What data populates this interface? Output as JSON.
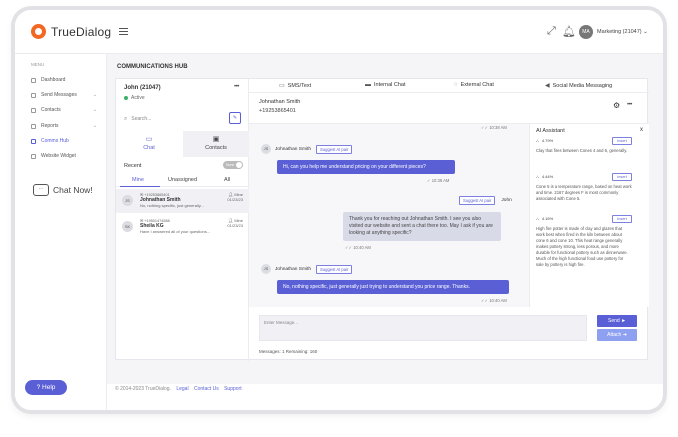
{
  "brand": {
    "name": "TrueDialog",
    "accent": "#5a5fd6",
    "logo_color": "#f26722"
  },
  "topbar": {
    "icons": [
      "expand-icon",
      "bell-icon"
    ],
    "avatar_initials": "MA",
    "account_label": "Marketing (21047)"
  },
  "sidebar": {
    "heading": "MENU",
    "items": [
      {
        "label": "Dashboard",
        "has_chevron": false
      },
      {
        "label": "Send Messages",
        "has_chevron": true
      },
      {
        "label": "Contacts",
        "has_chevron": true
      },
      {
        "label": "Reports",
        "has_chevron": true
      },
      {
        "label": "Comms Hub",
        "has_chevron": false,
        "active": true
      },
      {
        "label": "Website Widget",
        "has_chevron": false
      }
    ],
    "chat_now": "Chat Now!",
    "help": "Help"
  },
  "main": {
    "title": "COMMUNICATIONS HUB",
    "account": {
      "name": "John (21047)",
      "status": "Active"
    },
    "search_placeholder": "Search...",
    "tabs": {
      "chat": "Chat",
      "contacts": "Contacts"
    },
    "recent_label": "Recent",
    "toggle_label": "None",
    "subtabs": {
      "mine": "Mine",
      "unassigned": "Unassigned",
      "all": "All"
    },
    "conversations": [
      {
        "initials": "JS",
        "phone": "+19253865401",
        "name": "Johnathan Smith",
        "preview": "No, nothing specific, just generally...",
        "owner": "Mine",
        "date": "01/23/23"
      },
      {
        "initials": "SK",
        "phone": "+19501474588",
        "name": "Sheila KG",
        "preview": "Have I answered all of your questions...",
        "owner": "Mine",
        "date": "01/23/23"
      }
    ]
  },
  "chat": {
    "channels": [
      "SMS/Text",
      "Internal Chat",
      "External Chat",
      "Social Media Messaging"
    ],
    "contact_name": "Johnathan Smith",
    "contact_phone": "+19253865401",
    "messages": {
      "time_top": "10:38 AM",
      "m1_sender": "Johnathan Smith",
      "m1_initials": "JS",
      "m1_suggest": "Suggest AI pair",
      "m1_text": "Hi, can you help me understand pricing on your different pieces?",
      "m1_time": "10:39 AM",
      "m2_suggest": "Suggest AI pair",
      "m2_sender": "John",
      "m2_text": "Thank you for reaching out Johnathan Smith. I see you also visited our website and sent a chat there too. May I ask if you are looking at anything specific?",
      "m2_time": "10:40 AM",
      "m3_sender": "Johnathan Smith",
      "m3_initials": "JS",
      "m3_suggest": "Suggest AI pair",
      "m3_text": "No, nothing specific, just generally just trying to understand you price range. Thanks.",
      "m3_time": "10:40 AM"
    },
    "composer_placeholder": "Enter Message...",
    "send": "Send",
    "attach": "Attach",
    "counter": "Messages: 1 Remaining: 160"
  },
  "ai": {
    "title": "AI Assistant",
    "close": "x",
    "insert": "Insert",
    "cards": [
      {
        "pct": "4.79%",
        "text": "Clay that fires between Cones 4 and 6, generally."
      },
      {
        "pct": "4.44%",
        "text": "Cone 5 is a temperature range, based on heat work and time. 2167 degrees F is most commonly associated with Cone 5."
      },
      {
        "pct": "4.16%",
        "text": "High fire potter is made of clay and glazes that work best when fired in the kiln between about cone 6 and cone 10. This heat range generally makes pottery strong, less porous, and more durable for functional pottery such as dinnerware. Much of the high functional food use pottery for sale by pottery is high fire."
      }
    ]
  },
  "footer": {
    "copyright": "© 2014-2023 TrueDialog.",
    "links": [
      "Legal",
      "Contact Us",
      "Support"
    ]
  }
}
